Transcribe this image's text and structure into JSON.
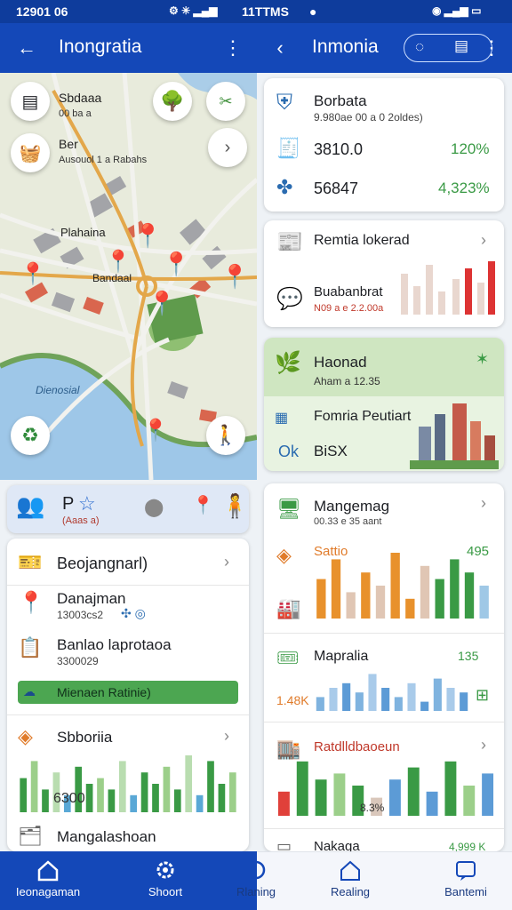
{
  "status": {
    "left_time": "12901 06",
    "mid_time": "11TTMS"
  },
  "left_bar": {
    "title": "Inongratia"
  },
  "right_bar": {
    "title": "Inmonia"
  },
  "map": {
    "tl_label": "Sbdaaa",
    "tl_sub": "00 ba a",
    "second_label": "Ber",
    "second_sub": "Ausouol 1 a Rabahs",
    "pin_label": "Plahaina",
    "center_label": "Bandaal",
    "water_label": "Dienosial"
  },
  "strip": {
    "title": "P",
    "sub": "(Aaas a)"
  },
  "left_list": {
    "row1": "Beojangnarl)",
    "row2": "Danajman",
    "row2_sub": "13003cs2",
    "row3": "Banlao laprotaoa",
    "row3_sub": "3300029",
    "green_label": "Mienaen Ratinie)",
    "row4": "Sbboriia",
    "chart_label": "6300",
    "row5": "Mangalashoan",
    "chart_values": [
      6,
      9,
      4,
      7,
      3,
      8,
      5,
      6,
      4,
      9,
      3,
      7,
      5,
      8,
      4,
      10,
      3,
      9,
      5,
      7
    ]
  },
  "right_top": {
    "title": "Borbata",
    "sub": "9.980ae 00 a 0 2oldes)",
    "row2_val": "3810.0",
    "row2_pct": "120%",
    "row3_val": "56847",
    "row3_pct": "4,323%"
  },
  "right_card2": {
    "title": "Remtia lokerad",
    "sub": "Buabanbrat",
    "sub2": "N09 a e 2.2.00a"
  },
  "right_green": {
    "title": "Haonad",
    "sub": "Aham a 12.35",
    "row": "Fomria Peutiart",
    "ok": "Ok",
    "val": "BiSX"
  },
  "right_card3": {
    "title": "Mangemag",
    "sub": "00.33 e 35 aant",
    "row2": "Sattio",
    "row2_val": "495",
    "row3": "Mapralia",
    "row3_val": "135",
    "row3_left": "1.48K",
    "row4": "Ratdlldbaoeun",
    "row4_val": "8.3%",
    "row5": "Nakaga",
    "row5_val": "4,999 K",
    "bars1": [
      6,
      9,
      4,
      7,
      5,
      10,
      3,
      8,
      6,
      9,
      7,
      5
    ],
    "bars2": [
      3,
      5,
      6,
      4,
      8,
      5,
      3,
      6,
      2,
      7,
      5,
      4
    ],
    "bars3": [
      4,
      9,
      6,
      7,
      5,
      3,
      6,
      8,
      4,
      9,
      5,
      7
    ]
  },
  "nav": {
    "i1": "Ieonagaman",
    "i2": "Shoort",
    "i3": "Rlaning",
    "i4": "Realing",
    "i5": "Bantemi"
  }
}
